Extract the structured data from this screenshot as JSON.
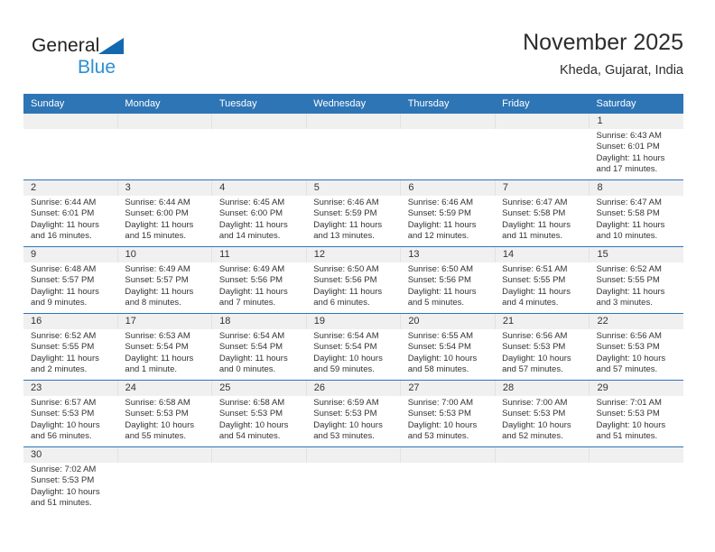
{
  "brand": {
    "name_part1": "General",
    "name_part2": "Blue",
    "triangle_icon": "triangle-icon"
  },
  "header": {
    "title": "November 2025",
    "location": "Kheda, Gujarat, India"
  },
  "colors": {
    "header_blue": "#2e75b6",
    "daynum_gray": "#f0f0f0",
    "brand_blue": "#2b8fd4",
    "triangle_blue": "#1269b0",
    "text": "#333333"
  },
  "weekdays": [
    "Sunday",
    "Monday",
    "Tuesday",
    "Wednesday",
    "Thursday",
    "Friday",
    "Saturday"
  ],
  "weeks": [
    [
      {
        "day": "",
        "sunrise": "",
        "sunset": "",
        "daylight1": "",
        "daylight2": ""
      },
      {
        "day": "",
        "sunrise": "",
        "sunset": "",
        "daylight1": "",
        "daylight2": ""
      },
      {
        "day": "",
        "sunrise": "",
        "sunset": "",
        "daylight1": "",
        "daylight2": ""
      },
      {
        "day": "",
        "sunrise": "",
        "sunset": "",
        "daylight1": "",
        "daylight2": ""
      },
      {
        "day": "",
        "sunrise": "",
        "sunset": "",
        "daylight1": "",
        "daylight2": ""
      },
      {
        "day": "",
        "sunrise": "",
        "sunset": "",
        "daylight1": "",
        "daylight2": ""
      },
      {
        "day": "1",
        "sunrise": "Sunrise: 6:43 AM",
        "sunset": "Sunset: 6:01 PM",
        "daylight1": "Daylight: 11 hours",
        "daylight2": "and 17 minutes."
      }
    ],
    [
      {
        "day": "2",
        "sunrise": "Sunrise: 6:44 AM",
        "sunset": "Sunset: 6:01 PM",
        "daylight1": "Daylight: 11 hours",
        "daylight2": "and 16 minutes."
      },
      {
        "day": "3",
        "sunrise": "Sunrise: 6:44 AM",
        "sunset": "Sunset: 6:00 PM",
        "daylight1": "Daylight: 11 hours",
        "daylight2": "and 15 minutes."
      },
      {
        "day": "4",
        "sunrise": "Sunrise: 6:45 AM",
        "sunset": "Sunset: 6:00 PM",
        "daylight1": "Daylight: 11 hours",
        "daylight2": "and 14 minutes."
      },
      {
        "day": "5",
        "sunrise": "Sunrise: 6:46 AM",
        "sunset": "Sunset: 5:59 PM",
        "daylight1": "Daylight: 11 hours",
        "daylight2": "and 13 minutes."
      },
      {
        "day": "6",
        "sunrise": "Sunrise: 6:46 AM",
        "sunset": "Sunset: 5:59 PM",
        "daylight1": "Daylight: 11 hours",
        "daylight2": "and 12 minutes."
      },
      {
        "day": "7",
        "sunrise": "Sunrise: 6:47 AM",
        "sunset": "Sunset: 5:58 PM",
        "daylight1": "Daylight: 11 hours",
        "daylight2": "and 11 minutes."
      },
      {
        "day": "8",
        "sunrise": "Sunrise: 6:47 AM",
        "sunset": "Sunset: 5:58 PM",
        "daylight1": "Daylight: 11 hours",
        "daylight2": "and 10 minutes."
      }
    ],
    [
      {
        "day": "9",
        "sunrise": "Sunrise: 6:48 AM",
        "sunset": "Sunset: 5:57 PM",
        "daylight1": "Daylight: 11 hours",
        "daylight2": "and 9 minutes."
      },
      {
        "day": "10",
        "sunrise": "Sunrise: 6:49 AM",
        "sunset": "Sunset: 5:57 PM",
        "daylight1": "Daylight: 11 hours",
        "daylight2": "and 8 minutes."
      },
      {
        "day": "11",
        "sunrise": "Sunrise: 6:49 AM",
        "sunset": "Sunset: 5:56 PM",
        "daylight1": "Daylight: 11 hours",
        "daylight2": "and 7 minutes."
      },
      {
        "day": "12",
        "sunrise": "Sunrise: 6:50 AM",
        "sunset": "Sunset: 5:56 PM",
        "daylight1": "Daylight: 11 hours",
        "daylight2": "and 6 minutes."
      },
      {
        "day": "13",
        "sunrise": "Sunrise: 6:50 AM",
        "sunset": "Sunset: 5:56 PM",
        "daylight1": "Daylight: 11 hours",
        "daylight2": "and 5 minutes."
      },
      {
        "day": "14",
        "sunrise": "Sunrise: 6:51 AM",
        "sunset": "Sunset: 5:55 PM",
        "daylight1": "Daylight: 11 hours",
        "daylight2": "and 4 minutes."
      },
      {
        "day": "15",
        "sunrise": "Sunrise: 6:52 AM",
        "sunset": "Sunset: 5:55 PM",
        "daylight1": "Daylight: 11 hours",
        "daylight2": "and 3 minutes."
      }
    ],
    [
      {
        "day": "16",
        "sunrise": "Sunrise: 6:52 AM",
        "sunset": "Sunset: 5:55 PM",
        "daylight1": "Daylight: 11 hours",
        "daylight2": "and 2 minutes."
      },
      {
        "day": "17",
        "sunrise": "Sunrise: 6:53 AM",
        "sunset": "Sunset: 5:54 PM",
        "daylight1": "Daylight: 11 hours",
        "daylight2": "and 1 minute."
      },
      {
        "day": "18",
        "sunrise": "Sunrise: 6:54 AM",
        "sunset": "Sunset: 5:54 PM",
        "daylight1": "Daylight: 11 hours",
        "daylight2": "and 0 minutes."
      },
      {
        "day": "19",
        "sunrise": "Sunrise: 6:54 AM",
        "sunset": "Sunset: 5:54 PM",
        "daylight1": "Daylight: 10 hours",
        "daylight2": "and 59 minutes."
      },
      {
        "day": "20",
        "sunrise": "Sunrise: 6:55 AM",
        "sunset": "Sunset: 5:54 PM",
        "daylight1": "Daylight: 10 hours",
        "daylight2": "and 58 minutes."
      },
      {
        "day": "21",
        "sunrise": "Sunrise: 6:56 AM",
        "sunset": "Sunset: 5:53 PM",
        "daylight1": "Daylight: 10 hours",
        "daylight2": "and 57 minutes."
      },
      {
        "day": "22",
        "sunrise": "Sunrise: 6:56 AM",
        "sunset": "Sunset: 5:53 PM",
        "daylight1": "Daylight: 10 hours",
        "daylight2": "and 57 minutes."
      }
    ],
    [
      {
        "day": "23",
        "sunrise": "Sunrise: 6:57 AM",
        "sunset": "Sunset: 5:53 PM",
        "daylight1": "Daylight: 10 hours",
        "daylight2": "and 56 minutes."
      },
      {
        "day": "24",
        "sunrise": "Sunrise: 6:58 AM",
        "sunset": "Sunset: 5:53 PM",
        "daylight1": "Daylight: 10 hours",
        "daylight2": "and 55 minutes."
      },
      {
        "day": "25",
        "sunrise": "Sunrise: 6:58 AM",
        "sunset": "Sunset: 5:53 PM",
        "daylight1": "Daylight: 10 hours",
        "daylight2": "and 54 minutes."
      },
      {
        "day": "26",
        "sunrise": "Sunrise: 6:59 AM",
        "sunset": "Sunset: 5:53 PM",
        "daylight1": "Daylight: 10 hours",
        "daylight2": "and 53 minutes."
      },
      {
        "day": "27",
        "sunrise": "Sunrise: 7:00 AM",
        "sunset": "Sunset: 5:53 PM",
        "daylight1": "Daylight: 10 hours",
        "daylight2": "and 53 minutes."
      },
      {
        "day": "28",
        "sunrise": "Sunrise: 7:00 AM",
        "sunset": "Sunset: 5:53 PM",
        "daylight1": "Daylight: 10 hours",
        "daylight2": "and 52 minutes."
      },
      {
        "day": "29",
        "sunrise": "Sunrise: 7:01 AM",
        "sunset": "Sunset: 5:53 PM",
        "daylight1": "Daylight: 10 hours",
        "daylight2": "and 51 minutes."
      }
    ],
    [
      {
        "day": "30",
        "sunrise": "Sunrise: 7:02 AM",
        "sunset": "Sunset: 5:53 PM",
        "daylight1": "Daylight: 10 hours",
        "daylight2": "and 51 minutes."
      },
      {
        "day": "",
        "sunrise": "",
        "sunset": "",
        "daylight1": "",
        "daylight2": ""
      },
      {
        "day": "",
        "sunrise": "",
        "sunset": "",
        "daylight1": "",
        "daylight2": ""
      },
      {
        "day": "",
        "sunrise": "",
        "sunset": "",
        "daylight1": "",
        "daylight2": ""
      },
      {
        "day": "",
        "sunrise": "",
        "sunset": "",
        "daylight1": "",
        "daylight2": ""
      },
      {
        "day": "",
        "sunrise": "",
        "sunset": "",
        "daylight1": "",
        "daylight2": ""
      },
      {
        "day": "",
        "sunrise": "",
        "sunset": "",
        "daylight1": "",
        "daylight2": ""
      }
    ]
  ]
}
